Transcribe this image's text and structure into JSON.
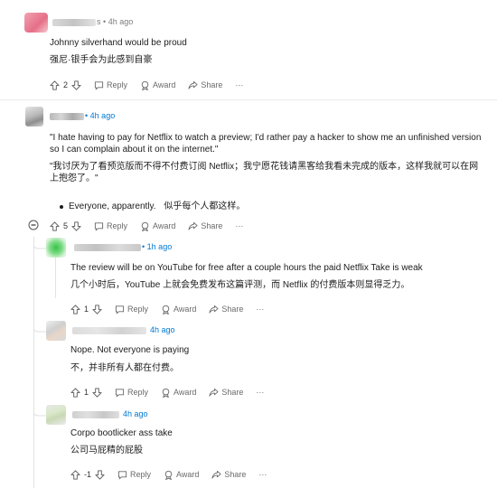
{
  "comments": [
    {
      "suffix": "s",
      "time": "4h ago",
      "text_en": "Johnny silverhand would be proud",
      "text_zh": "强尼·银手会为此感到自豪",
      "votes": "2"
    },
    {
      "time": "4h ago",
      "text_en": "\"I hate having to pay for Netflix to watch a preview; I'd rather pay a hacker to show me an unfinished version so I can complain about it on the internet.\"",
      "text_zh": "\"我讨厌为了看预览版而不得不付费订阅 Netflix；我宁愿花钱请黑客给我看未完成的版本，这样我就可以在网上抱怨了。\"",
      "bullet_en": "Everyone, apparently.",
      "bullet_zh": "似乎每个人都这样。",
      "votes": "5"
    },
    {
      "time": "1h ago",
      "text_en": "The review will be on YouTube for free after a couple hours the paid Netflix Take is weak",
      "text_zh": "几个小时后，YouTube 上就会免费发布这篇评测，而 Netflix 的付费版本则显得乏力。",
      "votes": "1"
    },
    {
      "time": "4h ago",
      "text_en": "Nope. Not everyone is paying",
      "text_zh": "不，并非所有人都在付费。",
      "votes": "1"
    },
    {
      "time": "4h ago",
      "text_en": "Corpo bootlicker ass take",
      "text_zh": "公司马屁精的屁股",
      "votes": "-1"
    }
  ],
  "actions": {
    "reply": "Reply",
    "award": "Award",
    "share": "Share",
    "more": "···",
    "dot": "•"
  },
  "colors": {
    "link": "#0079d3",
    "meta": "#7c7c7c"
  }
}
